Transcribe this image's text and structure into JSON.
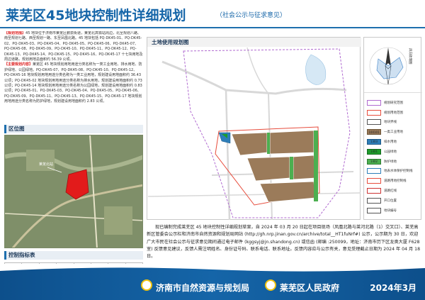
{
  "header": {
    "title": "莱芜区45地块控制性详细规划",
    "subtitle": "（社会公示与征求意见）"
  },
  "left": {
    "intro_tag": "【规划范围】",
    "intro_text": "45 地块位于济南市莱芜区鹏泉街道，莱芜北高铁站周边，北至规划八路、南至规划七路、西至规划一路、东至凤凰北路。45 地块包括 PQ-DK45-01、PQ-DK45-02、PQ-DK45-03、PQ-DK45-04、PQ-DK45-05、PQ-DK45-06、PQ-DK45-07、PQ-DK45-08、PQ-DK45-09、PQ-DK45-10、PQ-DK45-11、PQ-DK45-12、PQ-DK45-13、PQ-DK45-14、PQ-DK45-15、PQ-DK45-16、PQ-DK45-17 十七块用地及周边道路，规划用地总面积约 56.39 公顷。",
    "function_tag": "【主要规划内容】",
    "function_text": "莱芜区 45 地块规划用地用途分类名称为一类工业用地、排水用地、防护绿地、公园绿地。PQ-DK45-07、PQ-DK45-08、PQ-DK45-10、PQ-DK45-12、PQ-DK45-16 地块规划用地用途分类名称为一类工业用地，规划建设用地面积约 36.43 公顷；PQ-DK45-02 地块规划用地用途分类名称为排水用地，规划建设用地面积约 0.73 公顷；PQ-DK45-14 地块规划用地用途分类名称为公园绿地，规划建设用地面积约 0.83 公顷；PQ-DK45-01、PQ-DK45-03、PQ-DK45-04、PQ-DK45-05、PQ-DK45-06、PQ-DK45-09、PQ-DK45-11、PQ-DK45-13、PQ-DK45-15、PQ-DK45-17 地块规划用地用途分类名称为防护绿地，规划建设用地面积约 2.83 公顷。",
    "location_label": "区位图",
    "index_label": "控制指标表"
  },
  "main_map": {
    "title": "土地使用规划图"
  },
  "legend": {
    "north_label": "风向玫瑰图",
    "items": [
      {
        "code": "",
        "label": "规划研究范围",
        "color": "#ffffff",
        "border": "#b06ad0"
      },
      {
        "code": "",
        "label": "规划用地范围",
        "color": "#ffffff",
        "border": "#e74c3c"
      },
      {
        "code": "",
        "label": "地块界线",
        "color": "#ffffff",
        "border": "#555555"
      },
      {
        "code": "100101",
        "label": "一类工业用地",
        "color": "#9b7b5a",
        "border": "#6d5538"
      },
      {
        "code": "1303",
        "label": "排水用地",
        "color": "#2e7eb8",
        "border": "#1f5a88"
      },
      {
        "code": "1401",
        "label": "公园绿地",
        "color": "#1e9b2b",
        "border": "#146b1e"
      },
      {
        "code": "1402",
        "label": "防护绿地",
        "color": "#4caf50",
        "border": "#2e7d32"
      },
      {
        "code": "",
        "label": "地表水体保护控制线",
        "color": "#ffffff",
        "border": "#2e7eb8"
      },
      {
        "code": "",
        "label": "道路用地控制线",
        "color": "#ffffff",
        "border": "#e74c3c"
      },
      {
        "code": "",
        "label": "道路红线",
        "color": "#ffffff",
        "border": "#cc3333"
      },
      {
        "code": "",
        "label": "开口位置",
        "color": "#ffffff",
        "border": "#555555"
      },
      {
        "code": "",
        "label": "地块编号",
        "color": "#ffffff",
        "border": "#555555"
      }
    ]
  },
  "notice": {
    "text": "现已编制完成莱芜区 45 地块控制性详细规划草案，自 2024 年 03 月 20 日起在项目现场（凤凰北路与莱河北路（1）交叉口）、莱芜高新区管委会公示栏和济南市自然资源和规划局网站 (http://gh.nrp.jinan.gov.cn/archive/total__HT1fuNrf#) 公示，公示期为 30 日，欢迎广大市民在社会公示与征求意见期间通过电子邮件 (kggsyj@jn.shandong.cn) 或信函 (邮编 :250099，地址：济南市历下区龙奥大厦 F628 室) 反馈意见建议，反馈人需注明姓名、身份证号码、联系电话、联系地址。反馈内容应与公示有关，意见受理截止日期为 2024 年 04 月 18 日。"
  },
  "footer": {
    "org1": "济南市自然资源与规划局",
    "org2": "莱芜区人民政府",
    "date": "2024年3月"
  },
  "colors": {
    "brand_blue": "#1565a8",
    "footer_blue": "#0d4f8b"
  }
}
